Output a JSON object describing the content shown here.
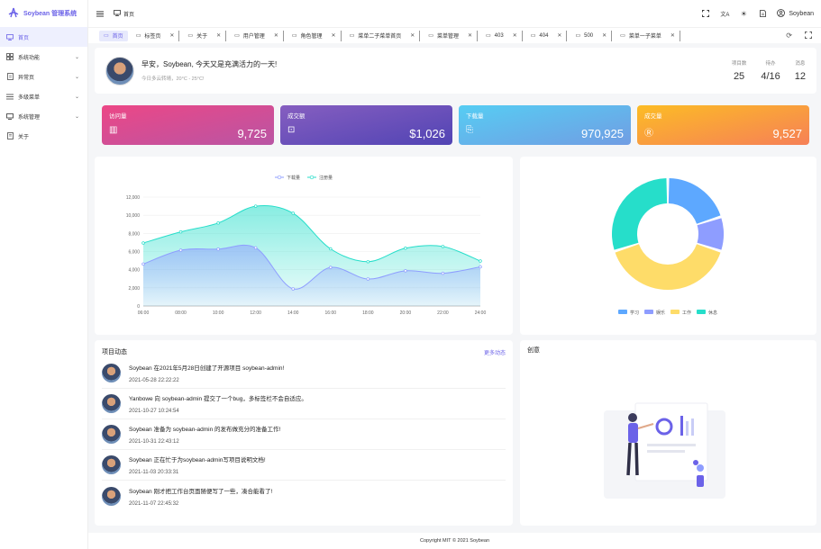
{
  "app": {
    "title": "Soybean 管理系统"
  },
  "sidebar": {
    "items": [
      {
        "label": "首页",
        "icon": "monitor-icon",
        "active": true,
        "expandable": false
      },
      {
        "label": "系统功能",
        "icon": "grid-icon",
        "expandable": true
      },
      {
        "label": "异常页",
        "icon": "exception-icon",
        "expandable": true
      },
      {
        "label": "多级菜单",
        "icon": "list-icon",
        "expandable": true
      },
      {
        "label": "系统管理",
        "icon": "settings-monitor-icon",
        "expandable": true
      },
      {
        "label": "关于",
        "icon": "doc-icon",
        "expandable": false
      }
    ]
  },
  "header": {
    "breadcrumb": "首页",
    "user": "Soybean"
  },
  "tabs": [
    {
      "label": "首页",
      "active": true
    },
    {
      "label": "标签页"
    },
    {
      "label": "关于"
    },
    {
      "label": "用户管理"
    },
    {
      "label": "角色管理"
    },
    {
      "label": "菜单二子菜单首页"
    },
    {
      "label": "菜单管理"
    },
    {
      "label": "403"
    },
    {
      "label": "404"
    },
    {
      "label": "500"
    },
    {
      "label": "菜单一子菜单"
    }
  ],
  "welcome": {
    "greeting": "早安，Soybean, 今天又是充满活力的一天!",
    "weather": "今日多云转晴，20°C - 25°C!",
    "stats": [
      {
        "label": "项目数",
        "value": "25"
      },
      {
        "label": "待办",
        "value": "4/16"
      },
      {
        "label": "消息",
        "value": "12"
      }
    ]
  },
  "cards": [
    {
      "title": "访问量",
      "value": "9,725",
      "icon": "bar-chart-icon",
      "from": "#ec4786",
      "to": "#b955a4"
    },
    {
      "title": "成交额",
      "value": "$1,026",
      "icon": "money-icon",
      "from": "#865ec0",
      "to": "#5144b4"
    },
    {
      "title": "下载量",
      "value": "970,925",
      "icon": "download-icon",
      "from": "#56cdf3",
      "to": "#719de3"
    },
    {
      "title": "成交量",
      "value": "9,527",
      "icon": "trade-icon",
      "from": "#fcbc25",
      "to": "#f68057"
    }
  ],
  "line_chart": {
    "chart_data": {
      "type": "area",
      "x": [
        "06:00",
        "08:00",
        "10:00",
        "12:00",
        "14:00",
        "16:00",
        "18:00",
        "20:00",
        "22:00",
        "24:00"
      ],
      "series": [
        {
          "name": "下载量",
          "values": [
            4623,
            6145,
            6268,
            6411,
            1890,
            4251,
            2978,
            3880,
            3606,
            4311
          ],
          "color": "#8e9dff"
        },
        {
          "name": "注册量",
          "values": [
            6943,
            8168,
            9144,
            11000,
            10226,
            6298,
            4890,
            6370,
            6564,
            4955
          ],
          "color": "#26deca"
        }
      ],
      "ylim": [
        0,
        12000
      ],
      "yticks": [
        "0",
        "2,000",
        "4,000",
        "6,000",
        "8,000",
        "10,000",
        "12,000"
      ],
      "legend": "top-center",
      "grid": true
    }
  },
  "pie_chart": {
    "chart_data": {
      "type": "pie",
      "categories": [
        "学习",
        "娱乐",
        "工作",
        "休息"
      ],
      "values": [
        20,
        10,
        40,
        30
      ],
      "colors": [
        "#5da8ff",
        "#8e9dff",
        "#fedc69",
        "#26deca"
      ],
      "legend": "bottom-center"
    }
  },
  "activity": {
    "title": "项目动态",
    "more": "更多动态",
    "items": [
      {
        "content": "Soybean 在2021年5月28日创建了开源项目 soybean-admin!",
        "time": "2021-05-28 22:22:22"
      },
      {
        "content": "Yanbowe 向 soybean-admin 提交了一个bug，多标签栏不会自适应。",
        "time": "2021-10-27 10:24:54"
      },
      {
        "content": "Soybean 准备为 soybean-admin 的发布做充分的准备工作!",
        "time": "2021-10-31 22:43:12"
      },
      {
        "content": "Soybean 正在忙于为soybean-admin写项目说明文档!",
        "time": "2021-11-03 20:33:31"
      },
      {
        "content": "Soybean 刚才把工作台页面随便写了一些，凑合能看了!",
        "time": "2021-11-07 22:45:32"
      }
    ]
  },
  "creative": {
    "title": "创意"
  },
  "footer": {
    "text": "Copyright MIT © 2021 Soybean"
  }
}
